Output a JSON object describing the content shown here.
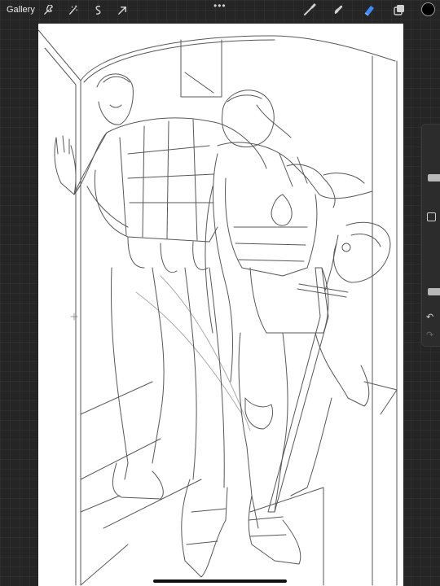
{
  "topbar": {
    "gallery_label": "Gallery",
    "left_tools": [
      {
        "name": "wrench-icon"
      },
      {
        "name": "magic-wand-icon"
      },
      {
        "name": "selection-icon"
      },
      {
        "name": "transform-arrow-icon"
      }
    ],
    "more_label": "•••",
    "right_tools": [
      {
        "name": "brush-icon"
      },
      {
        "name": "smudge-icon"
      },
      {
        "name": "eraser-icon",
        "active": true
      },
      {
        "name": "layers-icon"
      }
    ],
    "current_color": "#000000",
    "active_tool_color": "#3d8bfd"
  },
  "sidebar": {
    "brush_size_level": 0.35,
    "opacity_level": 0.1,
    "undo_label": "↶",
    "redo_label": "↷"
  },
  "canvas": {
    "background": "#ffffff",
    "content": "pencil-sketch"
  }
}
